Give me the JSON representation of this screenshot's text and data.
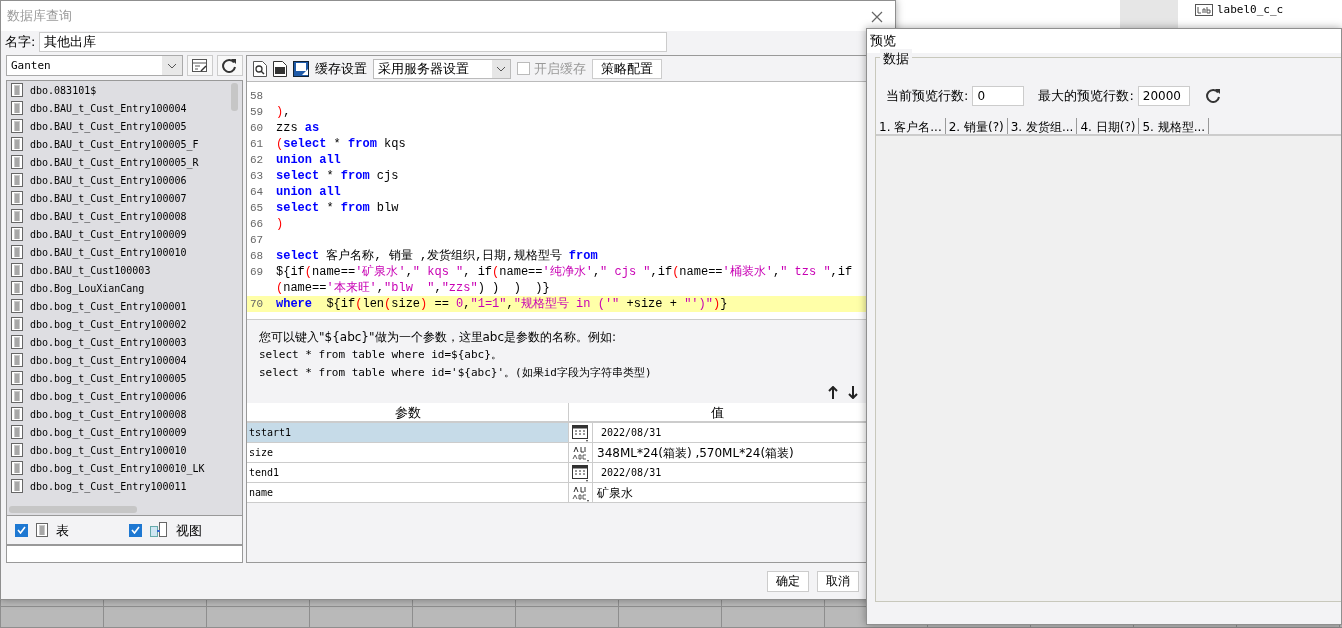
{
  "background": {
    "tree_items": [
      {
        "label": "label0_c_c"
      }
    ]
  },
  "query_dialog": {
    "title": "数据库查询",
    "name_label": "名字:",
    "name_value": "其他出库",
    "connection": "Ganten",
    "tables": [
      {
        "label": "dbo.083101$"
      },
      {
        "label": "dbo.BAU_t_Cust_Entry100004"
      },
      {
        "label": "dbo.BAU_t_Cust_Entry100005"
      },
      {
        "label": "dbo.BAU_t_Cust_Entry100005_F"
      },
      {
        "label": "dbo.BAU_t_Cust_Entry100005_R"
      },
      {
        "label": "dbo.BAU_t_Cust_Entry100006"
      },
      {
        "label": "dbo.BAU_t_Cust_Entry100007"
      },
      {
        "label": "dbo.BAU_t_Cust_Entry100008"
      },
      {
        "label": "dbo.BAU_t_Cust_Entry100009"
      },
      {
        "label": "dbo.BAU_t_Cust_Entry100010"
      },
      {
        "label": "dbo.BAU_t_Cust100003"
      },
      {
        "label": "dbo.Bog_LouXianCang"
      },
      {
        "label": "dbo.bog_t_Cust_Entry100001"
      },
      {
        "label": "dbo.bog_t_Cust_Entry100002"
      },
      {
        "label": "dbo.bog_t_Cust_Entry100003"
      },
      {
        "label": "dbo.bog_t_Cust_Entry100004"
      },
      {
        "label": "dbo.bog_t_Cust_Entry100005"
      },
      {
        "label": "dbo.bog_t_Cust_Entry100006"
      },
      {
        "label": "dbo.bog_t_Cust_Entry100008"
      },
      {
        "label": "dbo.bog_t_Cust_Entry100009"
      },
      {
        "label": "dbo.bog_t_Cust_Entry100010"
      },
      {
        "label": "dbo.bog_t_Cust_Entry100010_LK"
      },
      {
        "label": "dbo.bog_t_Cust_Entry100011"
      }
    ],
    "filters": [
      {
        "label": "表",
        "checked": true,
        "kind": "table"
      },
      {
        "label": "视图",
        "checked": true,
        "kind": "view"
      }
    ],
    "toolbar": {
      "cache_label": "缓存设置",
      "cache_mode": "采用服务器设置",
      "enable_cache": {
        "label": "开启缓存",
        "checked": false,
        "disabled": true
      },
      "strategy_button": "策略配置"
    },
    "code_lines": [
      {
        "number": "58",
        "highlighted": false
      },
      {
        "number": "59",
        "highlighted": false,
        "tokens": [
          {
            "t": ")",
            "kind": "p"
          },
          {
            "t": ",",
            "kind": "n"
          }
        ]
      },
      {
        "number": "60",
        "highlighted": false,
        "tokens": [
          {
            "t": "zzs ",
            "kind": "n"
          },
          {
            "t": "as",
            "kind": "kw"
          }
        ]
      },
      {
        "number": "61",
        "highlighted": false,
        "tokens": [
          {
            "t": "(",
            "kind": "p"
          },
          {
            "t": "select",
            "kind": "kw"
          },
          {
            "t": " * ",
            "kind": "n"
          },
          {
            "t": "from",
            "kind": "kw"
          },
          {
            "t": " kqs",
            "kind": "n"
          }
        ]
      },
      {
        "number": "62",
        "highlighted": false,
        "tokens": [
          {
            "t": "union all",
            "kind": "kw"
          }
        ]
      },
      {
        "number": "63",
        "highlighted": false,
        "tokens": [
          {
            "t": "select",
            "kind": "kw"
          },
          {
            "t": " * ",
            "kind": "n"
          },
          {
            "t": "from",
            "kind": "kw"
          },
          {
            "t": " cjs",
            "kind": "n"
          }
        ]
      },
      {
        "number": "64",
        "highlighted": false,
        "tokens": [
          {
            "t": "union all",
            "kind": "kw"
          }
        ]
      },
      {
        "number": "65",
        "highlighted": false,
        "tokens": [
          {
            "t": "select",
            "kind": "kw"
          },
          {
            "t": " * ",
            "kind": "n"
          },
          {
            "t": "from",
            "kind": "kw"
          },
          {
            "t": " blw",
            "kind": "n"
          }
        ]
      },
      {
        "number": "66",
        "highlighted": false,
        "tokens": [
          {
            "t": ")",
            "kind": "p"
          }
        ]
      },
      {
        "number": "67",
        "highlighted": false
      },
      {
        "number": "68",
        "highlighted": false,
        "tokens": [
          {
            "t": "select",
            "kind": "kw"
          },
          {
            "t": " 客户名称, 销量 ,发货组织,日期,规格型号 ",
            "kind": "n"
          },
          {
            "t": "from",
            "kind": "kw"
          }
        ]
      },
      {
        "number": "69",
        "highlighted": false,
        "tokens": [
          {
            "t": "${if",
            "kind": "n"
          },
          {
            "t": "(",
            "kind": "p"
          },
          {
            "t": "name==",
            "kind": "n"
          },
          {
            "t": "'矿泉水'",
            "kind": "s"
          },
          {
            "t": ",",
            "kind": "n"
          },
          {
            "t": "\" kqs \"",
            "kind": "s"
          },
          {
            "t": ", if",
            "kind": "n"
          },
          {
            "t": "(",
            "kind": "p"
          },
          {
            "t": "name==",
            "kind": "n"
          },
          {
            "t": "'纯净水'",
            "kind": "s"
          },
          {
            "t": ",",
            "kind": "n"
          },
          {
            "t": "\" cjs \"",
            "kind": "s"
          },
          {
            "t": ",if",
            "kind": "n"
          },
          {
            "t": "(",
            "kind": "p"
          },
          {
            "t": "name==",
            "kind": "n"
          },
          {
            "t": "'桶装水'",
            "kind": "s"
          },
          {
            "t": ",",
            "kind": "n"
          },
          {
            "t": "\" tzs \"",
            "kind": "s"
          },
          {
            "t": ",if",
            "kind": "n"
          },
          {
            "t": "(",
            "kind": "p"
          },
          {
            "t": "name==",
            "kind": "n"
          },
          {
            "t": "'本来旺'",
            "kind": "s"
          },
          {
            "t": ",",
            "kind": "n"
          },
          {
            "t": "\"blw  \"",
            "kind": "s"
          },
          {
            "t": ",",
            "kind": "n"
          },
          {
            "t": "\"zzs\"",
            "kind": "s"
          },
          {
            "t": ") )  )  )}",
            "kind": "n"
          }
        ]
      },
      {
        "number": "70",
        "highlighted": true,
        "tokens": [
          {
            "t": "where",
            "kind": "kw"
          },
          {
            "t": "  ${if",
            "kind": "n"
          },
          {
            "t": "(",
            "kind": "p"
          },
          {
            "t": "len",
            "kind": "n"
          },
          {
            "t": "(",
            "kind": "p"
          },
          {
            "t": "size",
            "kind": "n"
          },
          {
            "t": ")",
            "kind": "p"
          },
          {
            "t": " == ",
            "kind": "n"
          },
          {
            "t": "0",
            "kind": "s"
          },
          {
            "t": ",",
            "kind": "n"
          },
          {
            "t": "\"1=1\"",
            "kind": "s"
          },
          {
            "t": ",",
            "kind": "n"
          },
          {
            "t": "\"规格型号 in ('\"",
            "kind": "s"
          },
          {
            "t": " +size + ",
            "kind": "n"
          },
          {
            "t": "\"')\"",
            "kind": "s"
          },
          {
            "t": ")",
            "kind": "p"
          },
          {
            "t": "}",
            "kind": "n"
          }
        ]
      }
    ],
    "hint_lines": [
      "您可以键入\"${abc}\"做为一个参数，这里abc是参数的名称。例如:",
      "select * from table where id=${abc}。",
      "select * from table where id='${abc}'。(如果id字段为字符串类型)"
    ],
    "param_columns": [
      "参数",
      "值"
    ],
    "params": [
      {
        "name": "tstart1",
        "kind": "date",
        "value": "2022/08/31",
        "selected": true
      },
      {
        "name": "size",
        "kind": "text",
        "value": "348ML*24(箱装) ,570ML*24(箱装)",
        "selected": false
      },
      {
        "name": "tend1",
        "kind": "date",
        "value": "2022/08/31",
        "selected": false
      },
      {
        "name": "name",
        "kind": "text",
        "value": "矿泉水",
        "selected": false
      }
    ],
    "buttons": [
      "确定",
      "取消"
    ]
  },
  "preview": {
    "title": "预览",
    "group": "数据",
    "current_rows_label": "当前预览行数:",
    "current_rows": "0",
    "max_rows_label": "最大的预览行数:",
    "max_rows": "20000",
    "columns": [
      "1. 客户名...",
      "2. 销量(?)",
      "3. 发货组...",
      "4. 日期(?)",
      "5. 规格型..."
    ]
  }
}
